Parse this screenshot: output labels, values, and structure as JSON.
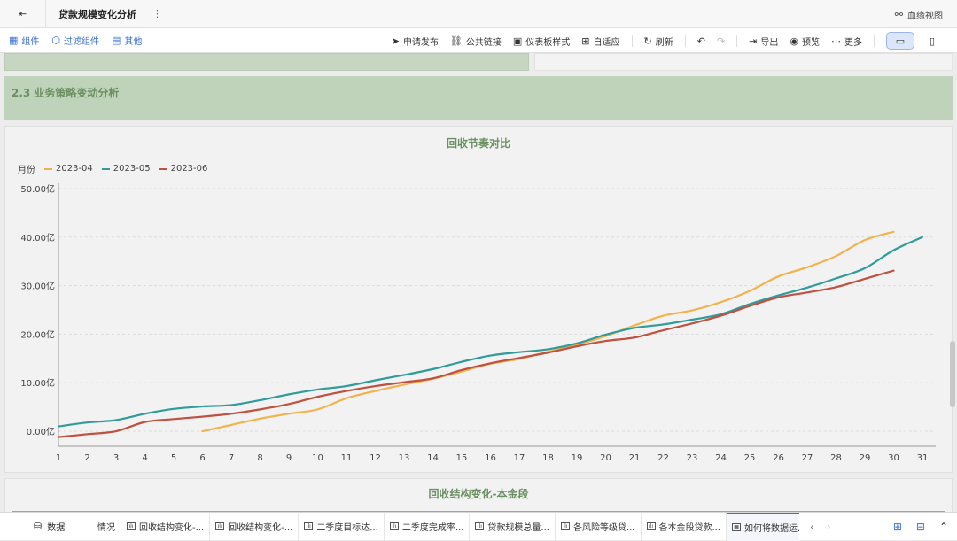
{
  "window": {
    "title": "贷款规模变化分析",
    "kebab": "⋮",
    "lineage_label": "血缘视图"
  },
  "toolbar": {
    "left": [
      {
        "label": "组件",
        "icon": "component-icon"
      },
      {
        "label": "过滤组件",
        "icon": "filter-icon"
      },
      {
        "label": "其他",
        "icon": "other-icon"
      }
    ],
    "right": [
      {
        "label": "申请发布",
        "icon": "send-icon"
      },
      {
        "label": "公共链接",
        "icon": "link-icon"
      },
      {
        "label": "仪表板样式",
        "icon": "style-icon"
      },
      {
        "label": "自适应",
        "icon": "adapt-icon"
      },
      {
        "label": "刷新",
        "icon": "refresh-icon"
      },
      {
        "label": "导出",
        "icon": "export-icon"
      },
      {
        "label": "预览",
        "icon": "preview-icon"
      },
      {
        "label": "更多",
        "icon": "more-icon"
      }
    ]
  },
  "section": {
    "title": "2.3 业务策略变动分析"
  },
  "chart_data": {
    "type": "line",
    "title": "回收节奏对比",
    "legend_title": "月份",
    "legend_position": "top-left",
    "ylabel": "",
    "xlabel": "",
    "y_unit": "亿",
    "ylim": [
      0,
      50
    ],
    "yticks": [
      "0.00亿",
      "10.00亿",
      "20.00亿",
      "30.00亿",
      "40.00亿",
      "50.00亿"
    ],
    "grid": true,
    "x": [
      1,
      2,
      3,
      4,
      5,
      6,
      7,
      8,
      9,
      10,
      11,
      12,
      13,
      14,
      15,
      16,
      17,
      18,
      19,
      20,
      21,
      22,
      23,
      24,
      25,
      26,
      27,
      28,
      29,
      30,
      31
    ],
    "series": [
      {
        "name": "2023-04",
        "color": "#f2b24c",
        "x_start": 6,
        "values": [
          null,
          null,
          null,
          null,
          null,
          0.0,
          1.3,
          2.6,
          3.6,
          4.5,
          6.8,
          8.3,
          9.6,
          10.8,
          12.3,
          13.9,
          14.9,
          16.4,
          17.8,
          19.6,
          21.8,
          23.8,
          24.9,
          26.6,
          28.9,
          31.9,
          33.8,
          36.1,
          39.4,
          41.1,
          null
        ]
      },
      {
        "name": "2023-05",
        "color": "#2f9c9a",
        "x_start": 1,
        "values": [
          1.0,
          1.8,
          2.3,
          3.6,
          4.6,
          5.1,
          5.4,
          6.4,
          7.6,
          8.6,
          9.3,
          10.5,
          11.6,
          12.8,
          14.3,
          15.6,
          16.3,
          16.9,
          18.1,
          19.9,
          21.3,
          22.0,
          23.0,
          24.1,
          26.2,
          28.0,
          29.6,
          31.5,
          33.6,
          37.3,
          40.0
        ]
      },
      {
        "name": "2023-06",
        "color": "#c0503f",
        "x_start": 1,
        "values": [
          -1.2,
          -0.6,
          0.0,
          1.9,
          2.5,
          3.0,
          3.6,
          4.5,
          5.6,
          7.1,
          8.3,
          9.3,
          10.1,
          10.9,
          12.6,
          14.0,
          15.1,
          16.2,
          17.5,
          18.6,
          19.3,
          20.8,
          22.2,
          23.8,
          25.8,
          27.6,
          28.6,
          29.7,
          31.4,
          33.1,
          null
        ]
      }
    ]
  },
  "next_card": {
    "title": "回收结构变化-本金段"
  },
  "bottombar": {
    "data_label": "数据",
    "tabs": [
      {
        "label": "情况",
        "active": false
      },
      {
        "label": "回收结构变化-...",
        "active": false
      },
      {
        "label": "回收结构变化-...",
        "active": false
      },
      {
        "label": "二季度目标达...",
        "active": false
      },
      {
        "label": "二季度完成率...",
        "active": false
      },
      {
        "label": "贷款规模总量...",
        "active": false
      },
      {
        "label": "各风险等级贷...",
        "active": false
      },
      {
        "label": "各本金段贷款...",
        "active": false
      },
      {
        "label": "如何将数据运...",
        "active": true
      }
    ]
  }
}
